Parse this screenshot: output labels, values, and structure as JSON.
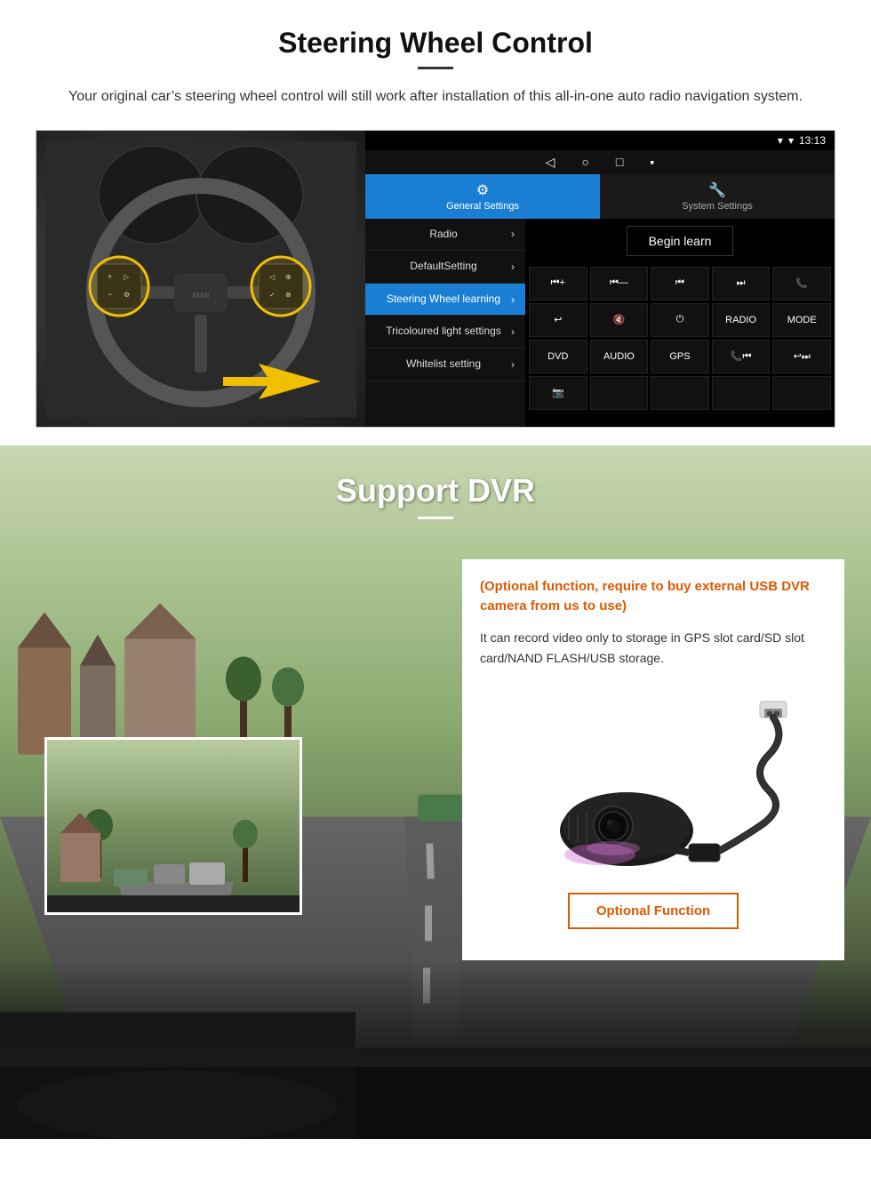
{
  "steering": {
    "title": "Steering Wheel Control",
    "subtitle": "Your original car’s steering wheel control will still work after installation of this all-in-one auto radio navigation system.",
    "status_bar": {
      "time": "13:13",
      "icons": [
        "wifi",
        "signal",
        "battery"
      ]
    },
    "tabs": [
      {
        "label": "General Settings",
        "active": true,
        "icon": "⚙"
      },
      {
        "label": "System Settings",
        "active": false,
        "icon": "🔧"
      }
    ],
    "menu_items": [
      {
        "label": "Radio",
        "active": false,
        "arrow": "›"
      },
      {
        "label": "DefaultSetting",
        "active": false,
        "arrow": "›"
      },
      {
        "label": "Steering Wheel learning",
        "active": true,
        "arrow": "›"
      },
      {
        "label": "Tricoloured light settings",
        "active": false,
        "arrow": "›"
      },
      {
        "label": "Whitelist setting",
        "active": false,
        "arrow": "›"
      }
    ],
    "begin_learn_label": "Begin learn",
    "control_buttons": [
      "⏮+",
      "⏮—",
      "⏮⏮",
      "⏭⏭",
      "📞",
      "↩",
      "🔇",
      "⏻",
      "RADIO",
      "MODE",
      "DVD",
      "AUDIO",
      "GPS",
      "📞⏮",
      "↩⏭",
      "📷",
      "",
      "",
      "",
      ""
    ]
  },
  "dvr": {
    "title": "Support DVR",
    "optional_text": "(Optional function, require to buy external USB DVR camera from us to use)",
    "description": "It can record video only to storage in GPS slot card/SD slot card/NAND FLASH/USB storage.",
    "optional_function_label": "Optional Function",
    "camera_label": "USB DVR Camera"
  }
}
